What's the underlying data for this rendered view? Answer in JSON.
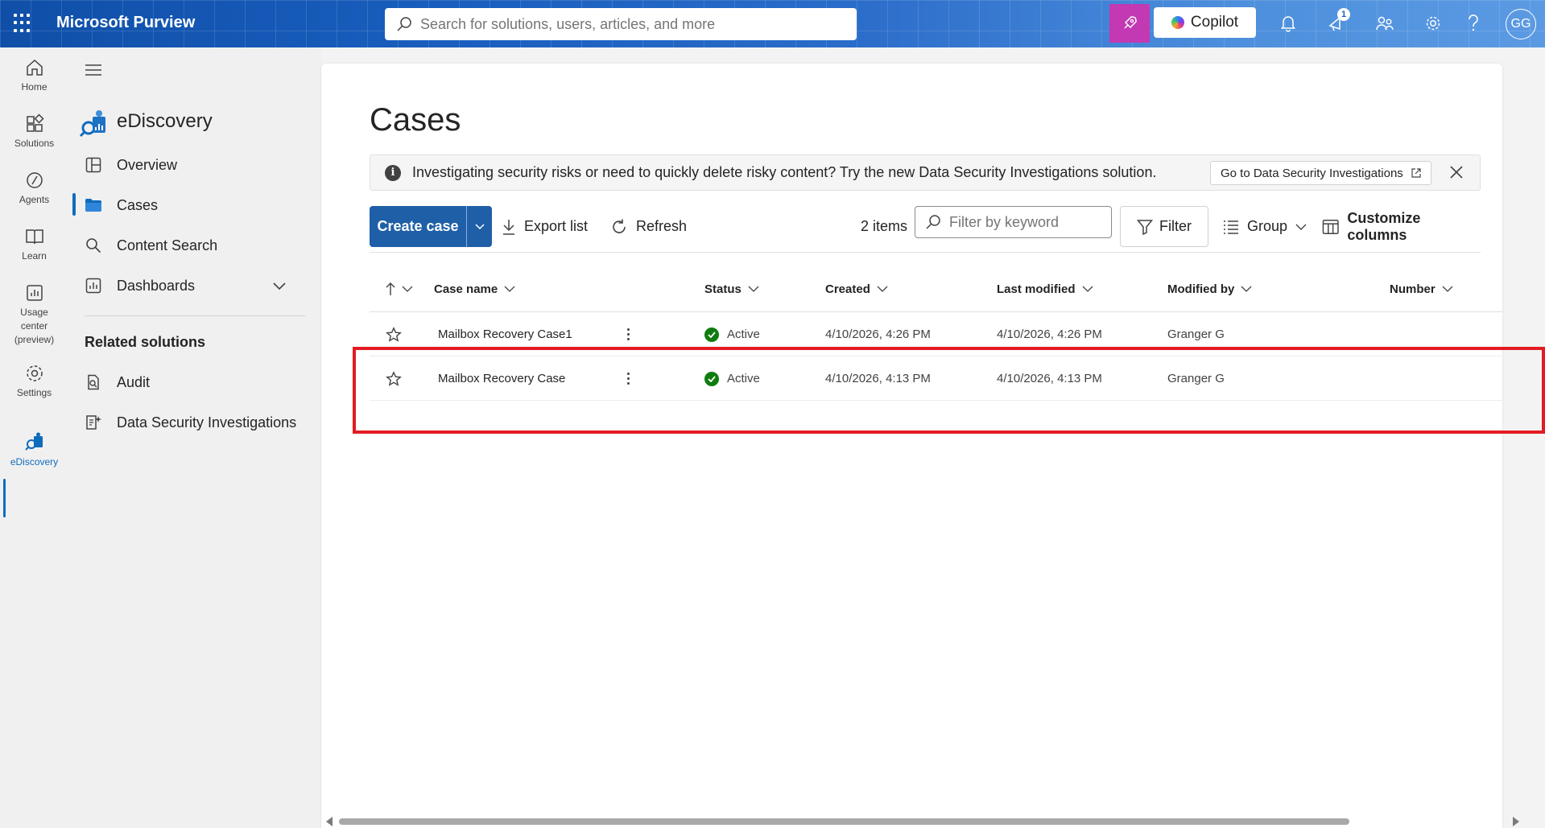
{
  "header": {
    "app_name": "Microsoft Purview",
    "search_placeholder": "Search for solutions, users, articles, and more",
    "copilot_label": "Copilot",
    "notification_badge": "1",
    "avatar_initials": "GG"
  },
  "rail": {
    "items": [
      {
        "label": "Home",
        "icon": "home-icon"
      },
      {
        "label": "Solutions",
        "icon": "solutions-icon"
      },
      {
        "label": "Agents",
        "icon": "agents-icon"
      },
      {
        "label": "Learn",
        "icon": "book-icon"
      },
      {
        "label": "Usage center (preview)",
        "icon": "chart-icon"
      },
      {
        "label": "Settings",
        "icon": "gear-icon"
      },
      {
        "label": "eDiscovery",
        "icon": "ediscovery-icon"
      }
    ]
  },
  "nav": {
    "title": "eDiscovery",
    "items": [
      {
        "label": "Overview"
      },
      {
        "label": "Cases"
      },
      {
        "label": "Content Search"
      },
      {
        "label": "Dashboards"
      }
    ],
    "related_title": "Related solutions",
    "related": [
      {
        "label": "Audit"
      },
      {
        "label": "Data Security Investigations"
      }
    ]
  },
  "main": {
    "title": "Cases",
    "banner_text": "Investigating security risks or need to quickly delete risky content? Try the new Data Security Investigations solution.",
    "banner_link": "Go to Data Security Investigations",
    "toolbar": {
      "create_label": "Create case",
      "export_label": "Export list",
      "refresh_label": "Refresh",
      "item_count": "2 items",
      "filter_placeholder": "Filter by keyword",
      "filter_label": "Filter",
      "group_label": "Group",
      "customize_label": "Customize columns"
    },
    "columns": [
      "Case name",
      "Status",
      "Created",
      "Last modified",
      "Modified by",
      "Number"
    ],
    "rows": [
      {
        "name": "Mailbox Recovery Case1",
        "status": "Active",
        "created": "4/10/2026, 4:26 PM",
        "modified": "4/10/2026, 4:26 PM",
        "modified_by": "Granger G"
      },
      {
        "name": "Mailbox Recovery Case",
        "status": "Active",
        "created": "4/10/2026, 4:13 PM",
        "modified": "4/10/2026, 4:13 PM",
        "modified_by": "Granger G"
      }
    ]
  },
  "colors": {
    "accent": "#0f6cbd",
    "primary_button": "#1f5fa8",
    "status_active": "#107c10",
    "highlight": "#e31b23",
    "copilot_pink": "#c239b3"
  }
}
